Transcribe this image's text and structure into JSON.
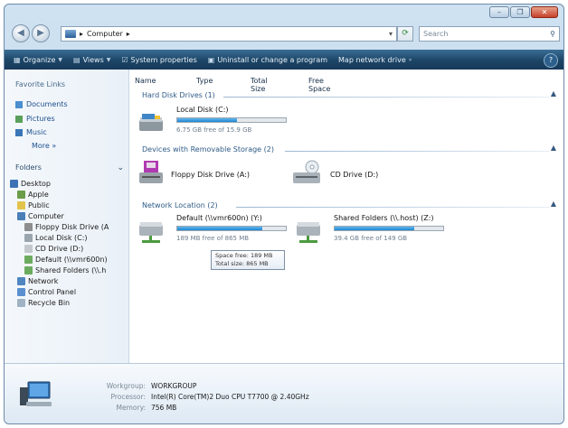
{
  "window": {
    "caption_buttons": [
      "–",
      "❐",
      "✕"
    ]
  },
  "address_bar": {
    "crumbs": [
      "Computer"
    ],
    "search_placeholder": "Search"
  },
  "toolbar": {
    "items": [
      "Organize",
      "Views",
      "System properties",
      "Uninstall or change a program",
      "Map network drive"
    ]
  },
  "sidebar": {
    "favorite_links_title": "Favorite Links",
    "favorites": [
      "Documents",
      "Pictures",
      "Music"
    ],
    "more_label": "More »",
    "folders_title": "Folders",
    "tree": [
      {
        "label": "Desktop",
        "depth": 0
      },
      {
        "label": "Apple",
        "depth": 1
      },
      {
        "label": "Public",
        "depth": 1
      },
      {
        "label": "Computer",
        "depth": 1
      },
      {
        "label": "Floppy Disk Drive (A",
        "depth": 2
      },
      {
        "label": "Local Disk (C:)",
        "depth": 2
      },
      {
        "label": "CD Drive (D:)",
        "depth": 2
      },
      {
        "label": "Default (\\\\vmr600n)",
        "depth": 2
      },
      {
        "label": "Shared Folders (\\\\.h",
        "depth": 2
      },
      {
        "label": "Network",
        "depth": 1
      },
      {
        "label": "Control Panel",
        "depth": 1
      },
      {
        "label": "Recycle Bin",
        "depth": 1
      }
    ]
  },
  "columns": [
    "Name",
    "Type",
    "Total Size",
    "Free Space"
  ],
  "groups": {
    "hdd_title": "Hard Disk Drives (1)",
    "removable_title": "Devices with Removable Storage (2)",
    "network_title": "Network Location (2)"
  },
  "drives": {
    "local": {
      "name": "Local Disk (C:)",
      "free": "6.75 GB free of 15.9 GB",
      "used_fraction": 0.55
    },
    "floppy": {
      "name": "Floppy Disk Drive (A:)"
    },
    "cd": {
      "name": "CD Drive (D:)"
    },
    "default": {
      "name": "Default (\\\\vmr600n) (Y:)",
      "free": "189 MB free of 865 MB",
      "used_fraction": 0.78
    },
    "shared": {
      "name": "Shared Folders (\\\\.host) (Z:)",
      "free": "39.4 GB free of 149 GB",
      "used_fraction": 0.73
    }
  },
  "tooltip": {
    "line1": "Space free: 189 MB",
    "line2": "Total size: 865 MB"
  },
  "details": {
    "workgroup_label": "Workgroup:",
    "workgroup_value": "WORKGROUP",
    "processor_label": "Processor:",
    "processor_value": "Intel(R) Core(TM)2 Duo CPU    T7700  @ 2.40GHz",
    "memory_label": "Memory:",
    "memory_value": "756 MB"
  },
  "colors": {
    "toolbar": "#1c4566",
    "link": "#1e4f8e",
    "bar_fill": "#1e86d0"
  }
}
